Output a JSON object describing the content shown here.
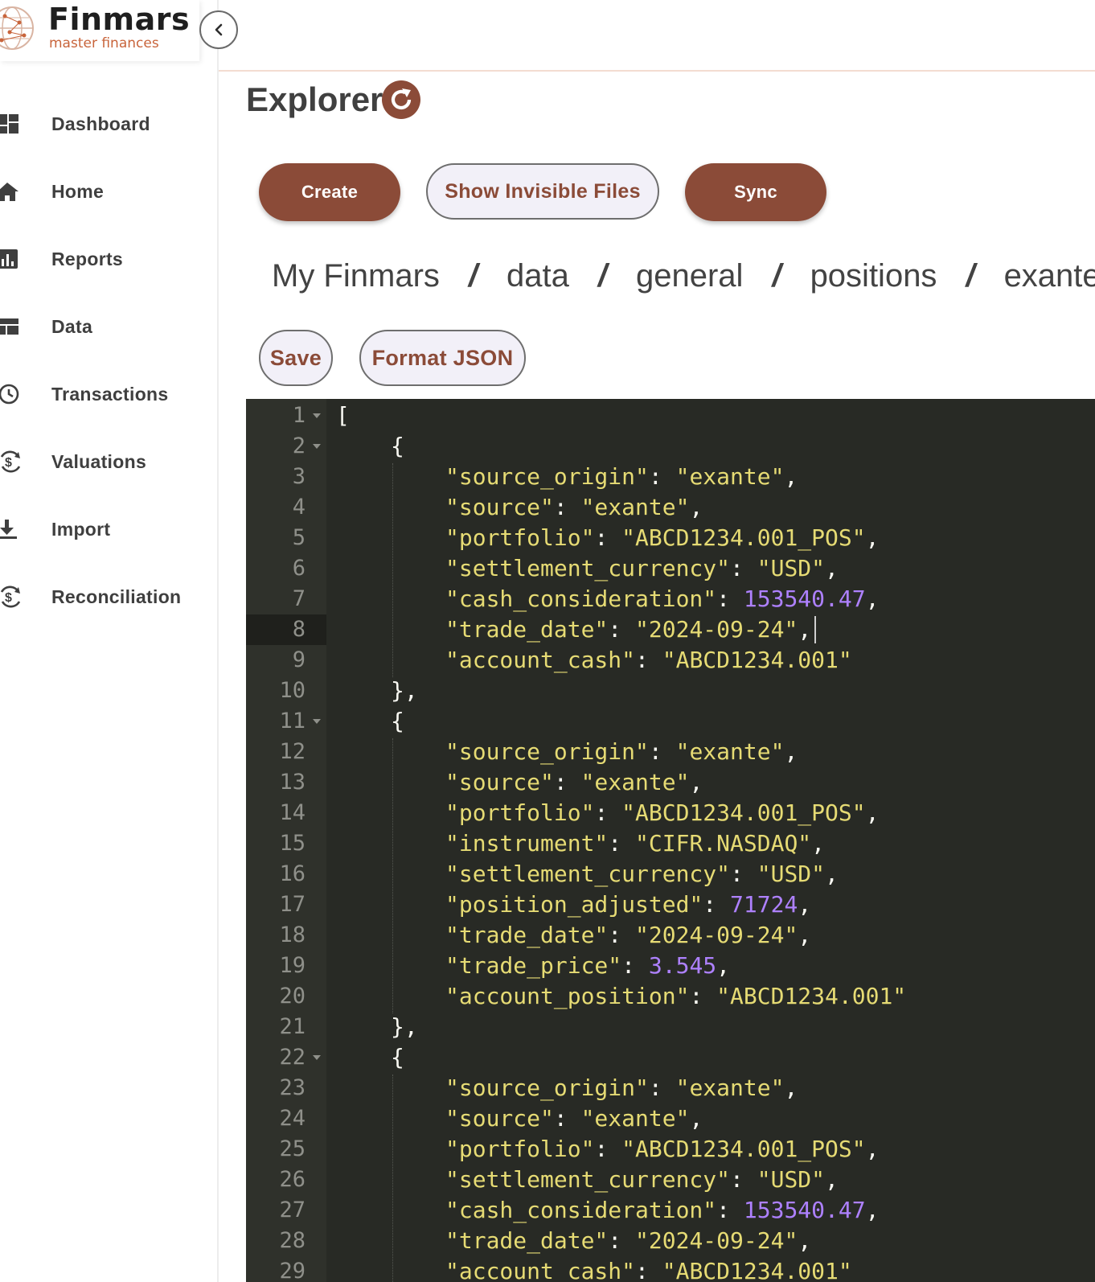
{
  "brand": {
    "name": "Finmars",
    "tagline": "master finances",
    "accent": "#8b4b38",
    "tagline_color": "#c8643b"
  },
  "sidebar": {
    "collapse_icon": "chevron-left-icon",
    "items": [
      {
        "label": "Dashboard",
        "icon": "dashboard-icon"
      },
      {
        "label": "Home",
        "icon": "home-icon"
      },
      {
        "label": "Reports",
        "icon": "bar-chart-icon"
      },
      {
        "label": "Data",
        "icon": "table-icon"
      },
      {
        "label": "Transactions",
        "icon": "history-icon"
      },
      {
        "label": "Valuations",
        "icon": "currency-cycle-icon"
      },
      {
        "label": "Import",
        "icon": "download-icon"
      },
      {
        "label": "Reconciliation",
        "icon": "currency-cycle-icon"
      }
    ]
  },
  "page": {
    "title": "Explorer",
    "refresh_icon": "refresh-icon"
  },
  "toolbar": {
    "create_label": "Create",
    "show_invisible_label": "Show Invisible Files",
    "sync_label": "Sync"
  },
  "breadcrumb": {
    "separator": "/",
    "items": [
      "My Finmars",
      "data",
      "general",
      "positions",
      "exante_c"
    ]
  },
  "editor_toolbar": {
    "save_label": "Save",
    "format_label": "Format JSON"
  },
  "editor": {
    "active_line": 8,
    "lines": [
      {
        "n": 1,
        "fold": true,
        "indent": 0,
        "tokens": [
          [
            "p",
            "["
          ]
        ]
      },
      {
        "n": 2,
        "fold": true,
        "indent": 1,
        "tokens": [
          [
            "p",
            "{"
          ]
        ]
      },
      {
        "n": 3,
        "indent": 2,
        "tokens": [
          [
            "k",
            "\"source_origin\""
          ],
          [
            "p",
            ": "
          ],
          [
            "s",
            "\"exante\""
          ],
          [
            "p",
            ","
          ]
        ]
      },
      {
        "n": 4,
        "indent": 2,
        "tokens": [
          [
            "k",
            "\"source\""
          ],
          [
            "p",
            ": "
          ],
          [
            "s",
            "\"exante\""
          ],
          [
            "p",
            ","
          ]
        ]
      },
      {
        "n": 5,
        "indent": 2,
        "tokens": [
          [
            "k",
            "\"portfolio\""
          ],
          [
            "p",
            ": "
          ],
          [
            "s",
            "\"ABCD1234.001_POS\""
          ],
          [
            "p",
            ","
          ]
        ]
      },
      {
        "n": 6,
        "indent": 2,
        "tokens": [
          [
            "k",
            "\"settlement_currency\""
          ],
          [
            "p",
            ": "
          ],
          [
            "s",
            "\"USD\""
          ],
          [
            "p",
            ","
          ]
        ]
      },
      {
        "n": 7,
        "indent": 2,
        "tokens": [
          [
            "k",
            "\"cash_consideration\""
          ],
          [
            "p",
            ": "
          ],
          [
            "n",
            "153540.47"
          ],
          [
            "p",
            ","
          ]
        ]
      },
      {
        "n": 8,
        "indent": 2,
        "tokens": [
          [
            "k",
            "\"trade_date\""
          ],
          [
            "p",
            ": "
          ],
          [
            "s",
            "\"2024-09-24\""
          ],
          [
            "p",
            ","
          ]
        ]
      },
      {
        "n": 9,
        "indent": 2,
        "tokens": [
          [
            "k",
            "\"account_cash\""
          ],
          [
            "p",
            ": "
          ],
          [
            "s",
            "\"ABCD1234.001\""
          ]
        ]
      },
      {
        "n": 10,
        "indent": 1,
        "tokens": [
          [
            "p",
            "},"
          ]
        ]
      },
      {
        "n": 11,
        "fold": true,
        "indent": 1,
        "tokens": [
          [
            "p",
            "{"
          ]
        ]
      },
      {
        "n": 12,
        "indent": 2,
        "tokens": [
          [
            "k",
            "\"source_origin\""
          ],
          [
            "p",
            ": "
          ],
          [
            "s",
            "\"exante\""
          ],
          [
            "p",
            ","
          ]
        ]
      },
      {
        "n": 13,
        "indent": 2,
        "tokens": [
          [
            "k",
            "\"source\""
          ],
          [
            "p",
            ": "
          ],
          [
            "s",
            "\"exante\""
          ],
          [
            "p",
            ","
          ]
        ]
      },
      {
        "n": 14,
        "indent": 2,
        "tokens": [
          [
            "k",
            "\"portfolio\""
          ],
          [
            "p",
            ": "
          ],
          [
            "s",
            "\"ABCD1234.001_POS\""
          ],
          [
            "p",
            ","
          ]
        ]
      },
      {
        "n": 15,
        "indent": 2,
        "tokens": [
          [
            "k",
            "\"instrument\""
          ],
          [
            "p",
            ": "
          ],
          [
            "s",
            "\"CIFR.NASDAQ\""
          ],
          [
            "p",
            ","
          ]
        ]
      },
      {
        "n": 16,
        "indent": 2,
        "tokens": [
          [
            "k",
            "\"settlement_currency\""
          ],
          [
            "p",
            ": "
          ],
          [
            "s",
            "\"USD\""
          ],
          [
            "p",
            ","
          ]
        ]
      },
      {
        "n": 17,
        "indent": 2,
        "tokens": [
          [
            "k",
            "\"position_adjusted\""
          ],
          [
            "p",
            ": "
          ],
          [
            "n",
            "71724"
          ],
          [
            "p",
            ","
          ]
        ]
      },
      {
        "n": 18,
        "indent": 2,
        "tokens": [
          [
            "k",
            "\"trade_date\""
          ],
          [
            "p",
            ": "
          ],
          [
            "s",
            "\"2024-09-24\""
          ],
          [
            "p",
            ","
          ]
        ]
      },
      {
        "n": 19,
        "indent": 2,
        "tokens": [
          [
            "k",
            "\"trade_price\""
          ],
          [
            "p",
            ": "
          ],
          [
            "n",
            "3.545"
          ],
          [
            "p",
            ","
          ]
        ]
      },
      {
        "n": 20,
        "indent": 2,
        "tokens": [
          [
            "k",
            "\"account_position\""
          ],
          [
            "p",
            ": "
          ],
          [
            "s",
            "\"ABCD1234.001\""
          ]
        ]
      },
      {
        "n": 21,
        "indent": 1,
        "tokens": [
          [
            "p",
            "},"
          ]
        ]
      },
      {
        "n": 22,
        "fold": true,
        "indent": 1,
        "tokens": [
          [
            "p",
            "{"
          ]
        ]
      },
      {
        "n": 23,
        "indent": 2,
        "tokens": [
          [
            "k",
            "\"source_origin\""
          ],
          [
            "p",
            ": "
          ],
          [
            "s",
            "\"exante\""
          ],
          [
            "p",
            ","
          ]
        ]
      },
      {
        "n": 24,
        "indent": 2,
        "tokens": [
          [
            "k",
            "\"source\""
          ],
          [
            "p",
            ": "
          ],
          [
            "s",
            "\"exante\""
          ],
          [
            "p",
            ","
          ]
        ]
      },
      {
        "n": 25,
        "indent": 2,
        "tokens": [
          [
            "k",
            "\"portfolio\""
          ],
          [
            "p",
            ": "
          ],
          [
            "s",
            "\"ABCD1234.001_POS\""
          ],
          [
            "p",
            ","
          ]
        ]
      },
      {
        "n": 26,
        "indent": 2,
        "tokens": [
          [
            "k",
            "\"settlement_currency\""
          ],
          [
            "p",
            ": "
          ],
          [
            "s",
            "\"USD\""
          ],
          [
            "p",
            ","
          ]
        ]
      },
      {
        "n": 27,
        "indent": 2,
        "tokens": [
          [
            "k",
            "\"cash_consideration\""
          ],
          [
            "p",
            ": "
          ],
          [
            "n",
            "153540.47"
          ],
          [
            "p",
            ","
          ]
        ]
      },
      {
        "n": 28,
        "indent": 2,
        "tokens": [
          [
            "k",
            "\"trade_date\""
          ],
          [
            "p",
            ": "
          ],
          [
            "s",
            "\"2024-09-24\""
          ],
          [
            "p",
            ","
          ]
        ]
      },
      {
        "n": 29,
        "indent": 2,
        "tokens": [
          [
            "k",
            "\"account_cash\""
          ],
          [
            "p",
            ": "
          ],
          [
            "s",
            "\"ABCD1234.001\""
          ]
        ]
      }
    ],
    "colors": {
      "background": "#282a25",
      "gutter": "#2f312b",
      "string": "#e6db74",
      "number": "#ae81ff",
      "punctuation": "#f8f8f2",
      "line_number": "#8f908a"
    }
  }
}
